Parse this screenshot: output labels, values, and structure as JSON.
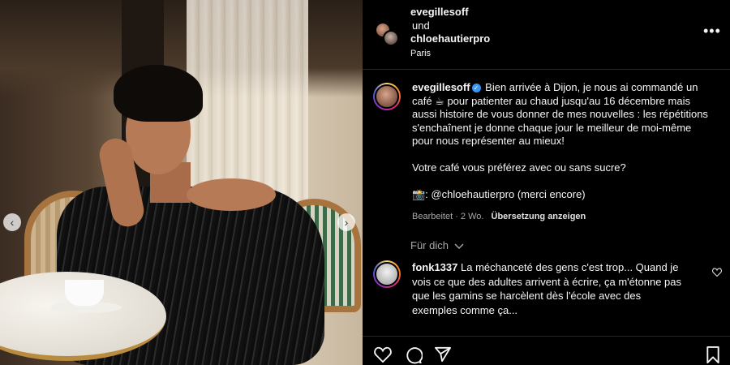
{
  "header": {
    "user1": "evegillesoff",
    "conjunction": "und",
    "user2": "chloehautierpro",
    "location": "Paris",
    "more_icon": "more-horizontal-icon"
  },
  "caption": {
    "username": "evegillesoff",
    "verified_mark": "✓",
    "text": "Bien arrivée à Dijon, je nous ai commandé un café ☕ pour patienter au chaud jusqu'au 16 décembre mais aussi histoire de vous donner de mes nouvelles : les répétitions s'enchaînent je donne chaque jour le meilleur de moi-même pour nous représenter au mieux!\n\nVotre café vous préférez avec ou sans sucre?\n\n📸: @chloehautierpro (merci encore)",
    "meta_time": "Bearbeitet · 2 Wo.",
    "translate_label": "Übersetzung anzeigen"
  },
  "for_you": "Für dich",
  "comment": {
    "username": "fonk1337",
    "text": "La méchanceté des gens c'est trop... Quand je vois ce que des adultes arrivent à écrire, ça m'étonne pas que les gamins se harcèlent dès l'école avec des exemples comme ça..."
  },
  "actions": {
    "like_icon": "heart-icon",
    "comment_icon": "comment-icon",
    "share_icon": "send-icon",
    "save_icon": "bookmark-icon"
  },
  "photo": {
    "prev_arrow": "‹",
    "next_arrow": "›"
  }
}
